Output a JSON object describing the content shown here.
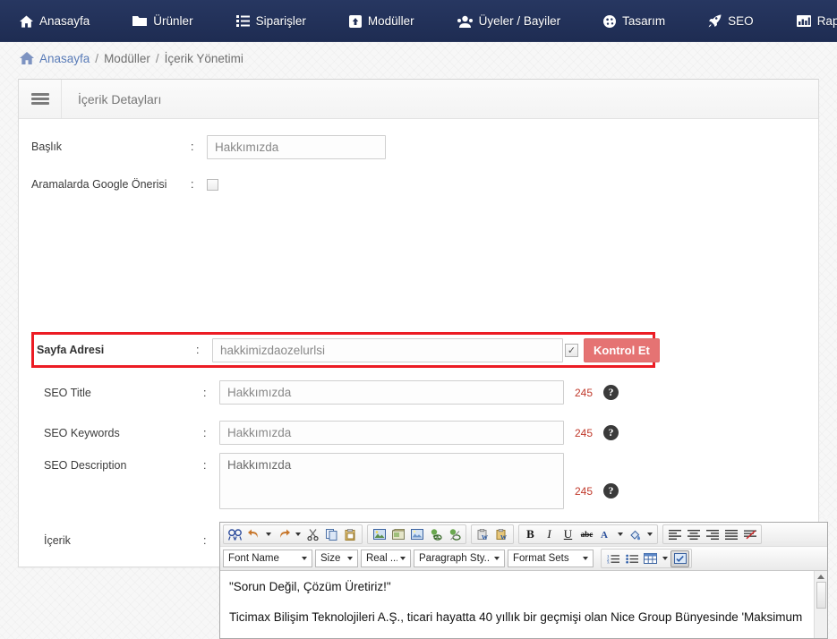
{
  "topnav": {
    "items": [
      {
        "label": "Anasayfa",
        "icon": "home-icon"
      },
      {
        "label": "Ürünler",
        "icon": "folder-icon"
      },
      {
        "label": "Siparişler",
        "icon": "list-icon"
      },
      {
        "label": "Modüller",
        "icon": "module-box-icon"
      },
      {
        "label": "Üyeler / Bayiler",
        "icon": "users-icon"
      },
      {
        "label": "Tasarım",
        "icon": "palette-icon"
      },
      {
        "label": "SEO",
        "icon": "rocket-icon"
      },
      {
        "label": "Raporlar",
        "icon": "chart-icon"
      }
    ],
    "background_color": "#223159"
  },
  "breadcrumb": {
    "home": "Anasayfa",
    "sep1": "/",
    "level2": "Modüller",
    "sep2": "/",
    "level3": "İçerik Yönetimi"
  },
  "panel": {
    "title": "İçerik Detayları"
  },
  "form": {
    "baslik": {
      "label": "Başlık",
      "colon": ":",
      "value": "Hakkımızda"
    },
    "google_onerisi": {
      "label": "Aramalarda Google Önerisi",
      "colon": ":",
      "checked": false
    },
    "sayfa_adresi": {
      "label": "Sayfa Adresi",
      "colon": ":",
      "value": "hakkimizdaozelurlsi",
      "checkbox_mark": "✓",
      "button_label": "Kontrol Et",
      "button_color": "#e57373",
      "highlight_color": "#ec1c24"
    },
    "seo_title": {
      "label": "SEO Title",
      "colon": ":",
      "value": "Hakkımızda",
      "counter": "245",
      "help": "?"
    },
    "seo_keywords": {
      "label": "SEO Keywords",
      "colon": ":",
      "value": "Hakkımızda",
      "counter": "245",
      "help": "?"
    },
    "seo_description": {
      "label": "SEO Description",
      "colon": ":",
      "value": "Hakkımızda",
      "counter": "245",
      "help": "?"
    },
    "icerik": {
      "label": "İçerik",
      "colon": ":"
    }
  },
  "editor": {
    "toolbar_row1": [
      {
        "group": 1,
        "icon": "find-replace-icon"
      },
      {
        "group": 1,
        "icon": "undo-icon"
      },
      {
        "group": 1,
        "icon": "undo-dropdown-caret"
      },
      {
        "group": 1,
        "icon": "redo-icon"
      },
      {
        "group": 1,
        "icon": "redo-dropdown-caret"
      },
      {
        "group": 1,
        "icon": "cut-scissors-icon"
      },
      {
        "group": 1,
        "icon": "copy-icon"
      },
      {
        "group": 1,
        "icon": "paste-icon"
      },
      {
        "group": 2,
        "icon": "insert-image-icon"
      },
      {
        "group": 2,
        "icon": "insert-flash-icon"
      },
      {
        "group": 2,
        "icon": "image-manager-icon"
      },
      {
        "group": 2,
        "icon": "hyperlink-icon"
      },
      {
        "group": 2,
        "icon": "remove-link-icon"
      },
      {
        "group": 3,
        "icon": "paste-from-word-icon"
      },
      {
        "group": 3,
        "icon": "paste-word-clean-icon"
      },
      {
        "group": 4,
        "icon": "bold-icon",
        "glyph": "B"
      },
      {
        "group": 4,
        "icon": "italic-icon",
        "glyph": "I"
      },
      {
        "group": 4,
        "icon": "underline-icon",
        "glyph": "U"
      },
      {
        "group": 4,
        "icon": "strikethrough-icon",
        "glyph": "abc"
      },
      {
        "group": 4,
        "icon": "font-color-icon",
        "glyph": "A"
      },
      {
        "group": 4,
        "icon": "font-color-caret"
      },
      {
        "group": 4,
        "icon": "highlight-color-icon"
      },
      {
        "group": 4,
        "icon": "highlight-color-caret"
      },
      {
        "group": 5,
        "icon": "align-left-icon"
      },
      {
        "group": 5,
        "icon": "align-center-icon"
      },
      {
        "group": 5,
        "icon": "align-right-icon"
      },
      {
        "group": 5,
        "icon": "align-justify-icon"
      },
      {
        "group": 5,
        "icon": "remove-formatting-icon"
      }
    ],
    "toolbar_row2": {
      "font_name": "Font Name",
      "size": "Size",
      "real_font_size": "Real ...",
      "paragraph_style": "Paragraph Sty..",
      "format_sets": "Format Sets",
      "buttons": [
        {
          "icon": "numbered-list-icon"
        },
        {
          "icon": "bulleted-list-icon"
        },
        {
          "icon": "insert-table-icon"
        },
        {
          "icon": "insert-table-caret"
        },
        {
          "icon": "module-manager-icon",
          "pressed": true
        }
      ]
    },
    "content": {
      "paragraph1": "\"Sorun Değil, Çözüm Üretiriz!\"",
      "paragraph2": "Ticimax Bilişim Teknolojileri A.Ş., ticari hayatta 40 yıllık bir geçmişi olan Nice Group Bünyesinde 'Maksimum"
    }
  }
}
